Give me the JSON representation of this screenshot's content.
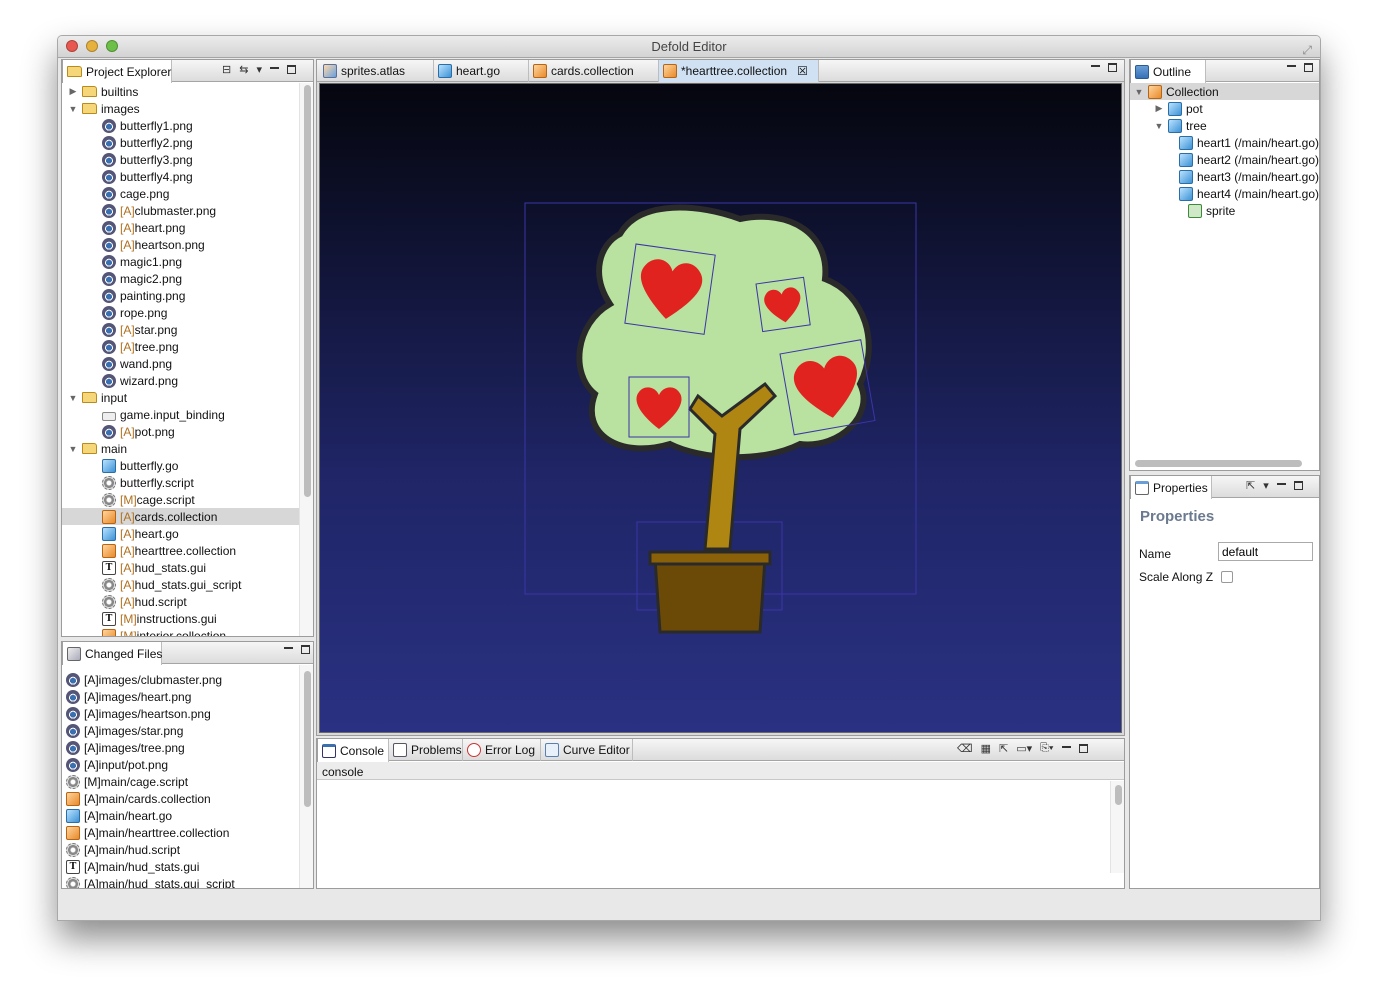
{
  "window": {
    "title": "Defold Editor"
  },
  "project_explorer": {
    "title": "Project Explorer",
    "items": [
      {
        "indent": 0,
        "arrow": "▶",
        "icon": "folder",
        "ann": "",
        "label": "builtins"
      },
      {
        "indent": 0,
        "arrow": "▼",
        "icon": "folder",
        "ann": "",
        "label": "images"
      },
      {
        "indent": 1,
        "arrow": "",
        "icon": "img",
        "ann": "",
        "label": "butterfly1.png"
      },
      {
        "indent": 1,
        "arrow": "",
        "icon": "img",
        "ann": "",
        "label": "butterfly2.png"
      },
      {
        "indent": 1,
        "arrow": "",
        "icon": "img",
        "ann": "",
        "label": "butterfly3.png"
      },
      {
        "indent": 1,
        "arrow": "",
        "icon": "img",
        "ann": "",
        "label": "butterfly4.png"
      },
      {
        "indent": 1,
        "arrow": "",
        "icon": "img",
        "ann": "",
        "label": "cage.png"
      },
      {
        "indent": 1,
        "arrow": "",
        "icon": "img",
        "ann": "[A]",
        "label": "clubmaster.png"
      },
      {
        "indent": 1,
        "arrow": "",
        "icon": "img",
        "ann": "[A]",
        "label": "heart.png"
      },
      {
        "indent": 1,
        "arrow": "",
        "icon": "img",
        "ann": "[A]",
        "label": "heartson.png"
      },
      {
        "indent": 1,
        "arrow": "",
        "icon": "img",
        "ann": "",
        "label": "magic1.png"
      },
      {
        "indent": 1,
        "arrow": "",
        "icon": "img",
        "ann": "",
        "label": "magic2.png"
      },
      {
        "indent": 1,
        "arrow": "",
        "icon": "img",
        "ann": "",
        "label": "painting.png"
      },
      {
        "indent": 1,
        "arrow": "",
        "icon": "img",
        "ann": "",
        "label": "rope.png"
      },
      {
        "indent": 1,
        "arrow": "",
        "icon": "img",
        "ann": "[A]",
        "label": "star.png"
      },
      {
        "indent": 1,
        "arrow": "",
        "icon": "img",
        "ann": "[A]",
        "label": "tree.png"
      },
      {
        "indent": 1,
        "arrow": "",
        "icon": "img",
        "ann": "",
        "label": "wand.png"
      },
      {
        "indent": 1,
        "arrow": "",
        "icon": "img",
        "ann": "",
        "label": "wizard.png"
      },
      {
        "indent": 0,
        "arrow": "▼",
        "icon": "folder",
        "ann": "",
        "label": "input"
      },
      {
        "indent": 1,
        "arrow": "",
        "icon": "bind",
        "ann": "",
        "label": "game.input_binding"
      },
      {
        "indent": 1,
        "arrow": "",
        "icon": "img",
        "ann": "[A]",
        "label": "pot.png"
      },
      {
        "indent": 0,
        "arrow": "▼",
        "icon": "folder",
        "ann": "",
        "label": "main"
      },
      {
        "indent": 1,
        "arrow": "",
        "icon": "go",
        "ann": "",
        "label": "butterfly.go"
      },
      {
        "indent": 1,
        "arrow": "",
        "icon": "script",
        "ann": "",
        "label": "butterfly.script"
      },
      {
        "indent": 1,
        "arrow": "",
        "icon": "script",
        "ann": "[M]",
        "label": "cage.script"
      },
      {
        "indent": 1,
        "arrow": "",
        "icon": "coll",
        "ann": "[A]",
        "label": "cards.collection",
        "selected": true
      },
      {
        "indent": 1,
        "arrow": "",
        "icon": "go",
        "ann": "[A]",
        "label": "heart.go"
      },
      {
        "indent": 1,
        "arrow": "",
        "icon": "coll",
        "ann": "[A]",
        "label": "hearttree.collection"
      },
      {
        "indent": 1,
        "arrow": "",
        "icon": "gui",
        "ann": "[A]",
        "label": "hud_stats.gui"
      },
      {
        "indent": 1,
        "arrow": "",
        "icon": "script",
        "ann": "[A]",
        "label": "hud_stats.gui_script"
      },
      {
        "indent": 1,
        "arrow": "",
        "icon": "script",
        "ann": "[A]",
        "label": "hud.script"
      },
      {
        "indent": 1,
        "arrow": "",
        "icon": "gui",
        "ann": "[M]",
        "label": "instructions.gui"
      },
      {
        "indent": 1,
        "arrow": "",
        "icon": "coll",
        "ann": "[M]",
        "label": "interior.collection"
      }
    ]
  },
  "changed_files": {
    "title": "Changed Files",
    "items": [
      {
        "icon": "img",
        "label": "[A]images/clubmaster.png"
      },
      {
        "icon": "img",
        "label": "[A]images/heart.png"
      },
      {
        "icon": "img",
        "label": "[A]images/heartson.png"
      },
      {
        "icon": "img",
        "label": "[A]images/star.png"
      },
      {
        "icon": "img",
        "label": "[A]images/tree.png"
      },
      {
        "icon": "img",
        "label": "[A]input/pot.png"
      },
      {
        "icon": "script",
        "label": "[M]main/cage.script"
      },
      {
        "icon": "coll",
        "label": "[A]main/cards.collection"
      },
      {
        "icon": "go",
        "label": "[A]main/heart.go"
      },
      {
        "icon": "coll",
        "label": "[A]main/hearttree.collection"
      },
      {
        "icon": "script",
        "label": "[A]main/hud.script"
      },
      {
        "icon": "gui",
        "label": "[A]main/hud_stats.gui"
      },
      {
        "icon": "script",
        "label": "[A]main/hud_stats.gui_script"
      }
    ]
  },
  "editor_tabs": [
    {
      "icon": "atlas",
      "label": "sprites.atlas"
    },
    {
      "icon": "go",
      "label": "heart.go"
    },
    {
      "icon": "coll",
      "label": "cards.collection"
    },
    {
      "icon": "coll",
      "label": "*hearttree.collection",
      "active": true
    }
  ],
  "outline": {
    "title": "Outline",
    "items": [
      {
        "indent": 0,
        "arrow": "▼",
        "icon": "coll",
        "label": "Collection",
        "selected": true
      },
      {
        "indent": 1,
        "arrow": "▶",
        "icon": "go",
        "label": "pot"
      },
      {
        "indent": 1,
        "arrow": "▼",
        "icon": "go",
        "label": "tree"
      },
      {
        "indent": 2,
        "arrow": "",
        "icon": "go",
        "label": "heart1 (/main/heart.go)"
      },
      {
        "indent": 2,
        "arrow": "",
        "icon": "go",
        "label": "heart2 (/main/heart.go)"
      },
      {
        "indent": 2,
        "arrow": "",
        "icon": "go",
        "label": "heart3 (/main/heart.go)"
      },
      {
        "indent": 2,
        "arrow": "",
        "icon": "go",
        "label": "heart4 (/main/heart.go)"
      },
      {
        "indent": 2,
        "arrow": "",
        "icon": "sprite",
        "label": "sprite"
      }
    ]
  },
  "properties": {
    "tab": "Properties",
    "title": "Properties",
    "name_label": "Name",
    "name_value": "default",
    "scale_label": "Scale Along Z",
    "scale_checked": false
  },
  "bottom": {
    "tabs": [
      {
        "icon": "console",
        "label": "Console",
        "active": true
      },
      {
        "icon": "problems",
        "label": "Problems"
      },
      {
        "icon": "err",
        "label": "Error Log"
      },
      {
        "icon": "curve",
        "label": "Curve Editor"
      }
    ],
    "console_label": "console"
  },
  "colors": {
    "canvas_top": "#05060e",
    "canvas_bottom": "#2a3182",
    "selection": "#4e47c8",
    "annotation": "#b07020"
  }
}
